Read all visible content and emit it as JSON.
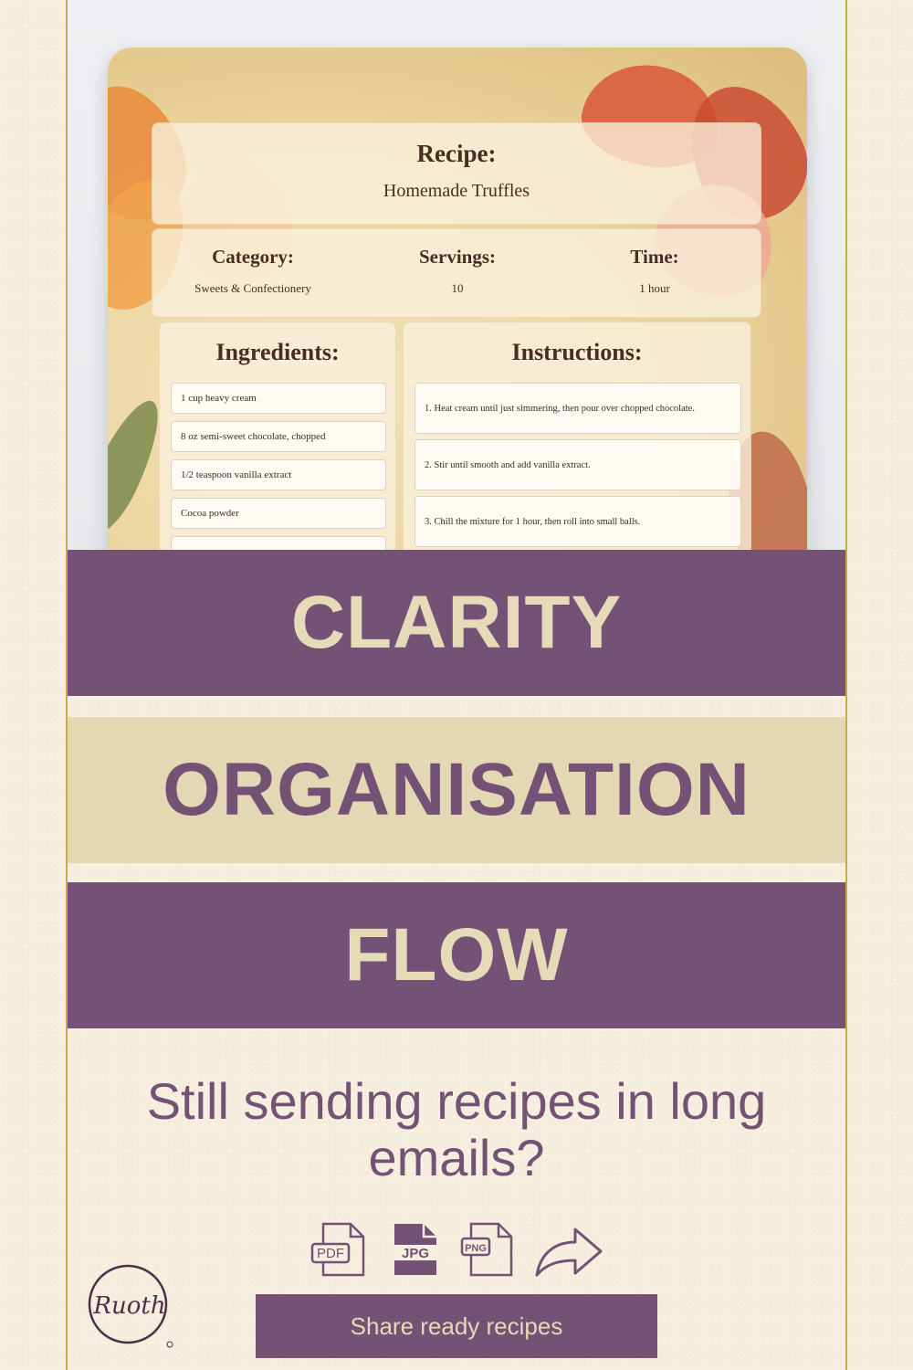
{
  "recipe_card": {
    "title_label": "Recipe:",
    "recipe_name": "Homemade Truffles",
    "category_label": "Category:",
    "category_value": "Sweets & Confectionery",
    "servings_label": "Servings:",
    "servings_value": "10",
    "time_label": "Time:",
    "time_value": "1 hour",
    "ingredients_label": "Ingredients:",
    "ingredients": [
      "1 cup heavy cream",
      "8 oz semi-sweet chocolate, chopped",
      "1/2 teaspoon vanilla extract",
      "Cocoa powder"
    ],
    "instructions_label": "Instructions:",
    "instructions": [
      "1. Heat cream until just simmering, then pour over chopped chocolate.",
      "2. Stir until smooth and add vanilla extract.",
      "3. Chill the mixture for 1 hour, then roll into small balls."
    ]
  },
  "bands": {
    "clarity": "CLARITY",
    "organisation": "ORGANISATION",
    "flow": "FLOW"
  },
  "tagline": "Still sending recipes in long emails?",
  "icons": [
    {
      "name": "pdf-file-icon",
      "label": "PDF"
    },
    {
      "name": "jpg-file-icon",
      "label": "JPG"
    },
    {
      "name": "png-file-icon",
      "label": "PNG"
    },
    {
      "name": "share-arrow-icon"
    }
  ],
  "cta_label": "Share ready recipes",
  "logo_text": "Ruoth",
  "colors": {
    "purple": "#745276",
    "beige": "#e4d8b4",
    "cream_text": "#e6dab8",
    "gold_line": "#c9a94c"
  }
}
